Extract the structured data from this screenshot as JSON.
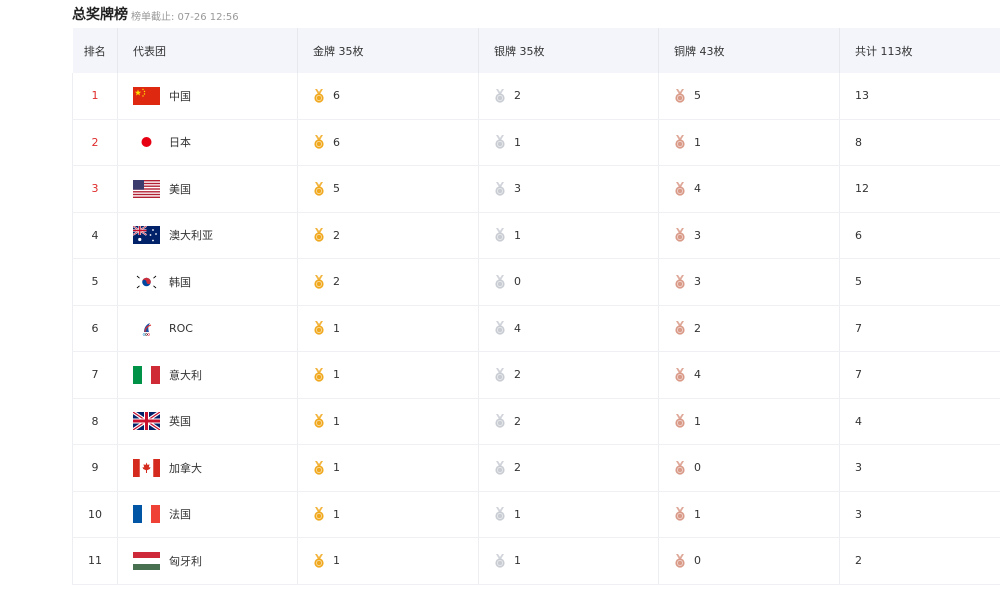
{
  "header": {
    "title": "总奖牌榜",
    "subtitle": "榜单截止: 07-26 12:56"
  },
  "table": {
    "columns": [
      "排名",
      "代表团",
      "金牌 35枚",
      "银牌 35枚",
      "铜牌 43枚",
      "共计 113枚"
    ],
    "rows": [
      {
        "rank": "1",
        "team": "中国",
        "flag": "flag-china-icon",
        "gold": "6",
        "silver": "2",
        "bronze": "5",
        "total": "13"
      },
      {
        "rank": "2",
        "team": "日本",
        "flag": "flag-japan-icon",
        "gold": "6",
        "silver": "1",
        "bronze": "1",
        "total": "8"
      },
      {
        "rank": "3",
        "team": "美国",
        "flag": "flag-usa-icon",
        "gold": "5",
        "silver": "3",
        "bronze": "4",
        "total": "12"
      },
      {
        "rank": "4",
        "team": "澳大利亚",
        "flag": "flag-australia-icon",
        "gold": "2",
        "silver": "1",
        "bronze": "3",
        "total": "6"
      },
      {
        "rank": "5",
        "team": "韩国",
        "flag": "flag-korea-icon",
        "gold": "2",
        "silver": "0",
        "bronze": "3",
        "total": "5"
      },
      {
        "rank": "6",
        "team": "ROC",
        "flag": "flag-roc-icon",
        "gold": "1",
        "silver": "4",
        "bronze": "2",
        "total": "7"
      },
      {
        "rank": "7",
        "team": "意大利",
        "flag": "flag-italy-icon",
        "gold": "1",
        "silver": "2",
        "bronze": "4",
        "total": "7"
      },
      {
        "rank": "8",
        "team": "英国",
        "flag": "flag-uk-icon",
        "gold": "1",
        "silver": "2",
        "bronze": "1",
        "total": "4"
      },
      {
        "rank": "9",
        "team": "加拿大",
        "flag": "flag-canada-icon",
        "gold": "1",
        "silver": "2",
        "bronze": "0",
        "total": "3"
      },
      {
        "rank": "10",
        "team": "法国",
        "flag": "flag-france-icon",
        "gold": "1",
        "silver": "1",
        "bronze": "1",
        "total": "3"
      },
      {
        "rank": "11",
        "team": "匈牙利",
        "flag": "flag-hungary-icon",
        "gold": "1",
        "silver": "1",
        "bronze": "0",
        "total": "2"
      }
    ]
  },
  "colors": {
    "gold": "#f0a81e",
    "silver": "#c9cdd3",
    "bronze": "#d99a88",
    "top_rank": "#e02b2b",
    "header_bg": "#f3f5fa"
  }
}
